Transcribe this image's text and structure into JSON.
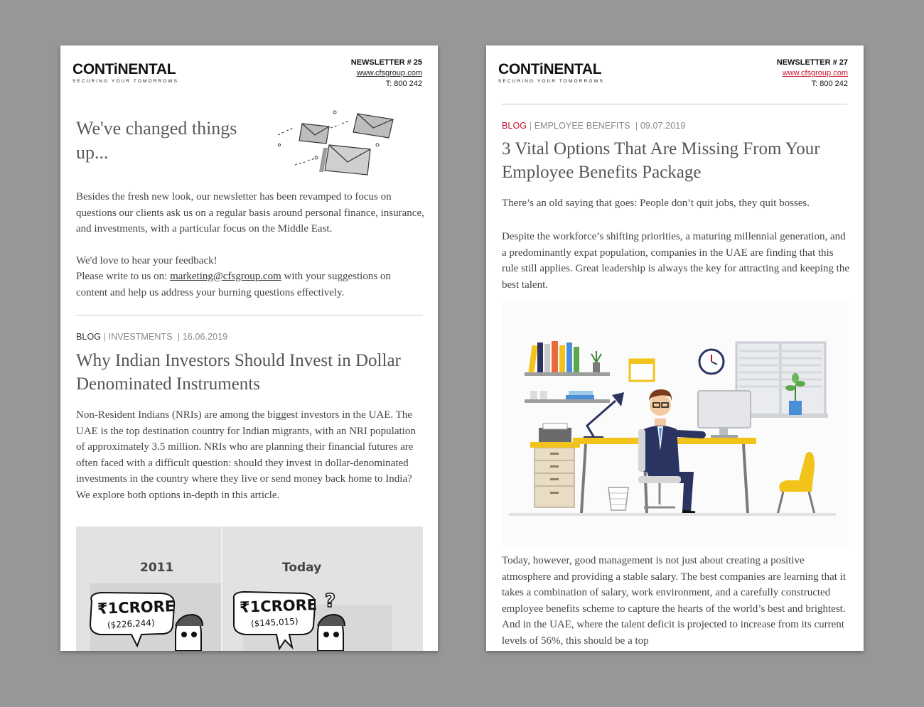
{
  "left": {
    "logo": {
      "wordmark": "CONTiNENTAL",
      "tagline": "SECURING YOUR TOMORROWS"
    },
    "newsletter": {
      "number": "NEWSLETTER # 25",
      "url": "www.cfsgroup.com",
      "phone": "T: 800 242"
    },
    "hero": {
      "title": "We've changed things up...",
      "paragraph1": "Besides the fresh new look, our newsletter has been revamped to focus on questions our clients ask us on a regular basis around personal finance, insurance, and investments, with a particular focus on the Middle East.",
      "paragraph2_line1": "We'd love to hear your feedback!",
      "paragraph2_prefix": "Please write to us on: ",
      "email": "marketing@cfsgroup.com",
      "paragraph2_suffix": " with your suggestions on content and help us address your burning questions effectively."
    },
    "article": {
      "category_main": "BLOG",
      "category_sub": "INVESTMENTS",
      "date": "16.06.2019",
      "title": "Why Indian Investors Should Invest in Dollar Denominated Instruments",
      "body": "Non-Resident Indians (NRIs) are among the biggest investors in the UAE. The UAE is the top destination country for Indian migrants, with an NRI population of approximately 3.5 million. NRIs who are planning their financial futures are often faced with a difficult question: should they invest in dollar-denominated investments in the country where they live or send money back home to India? We explore both options in-depth in this article."
    },
    "comic": {
      "label_left": "2011",
      "label_right": "Today",
      "bubble_left_main": "₹1CRORE",
      "bubble_left_sub": "($226,244)",
      "bubble_right_main": "₹1CRORE",
      "bubble_right_sub": "($145,015)",
      "question_mark": "?"
    }
  },
  "right": {
    "logo": {
      "wordmark": "CONTiNENTAL",
      "tagline": "SECURING YOUR TOMORROWS"
    },
    "newsletter": {
      "number": "NEWSLETTER # 27",
      "url": "www.cfsgroup.com",
      "phone": "T: 800 242"
    },
    "article": {
      "category_main": "BLOG",
      "category_sub": "EMPLOYEE BENEFITS",
      "date": "09.07.2019",
      "title": "3 Vital Options That Are Missing From Your Employee Benefits Package",
      "paragraph1": "There’s an old saying that goes: People don’t quit jobs, they quit bosses.",
      "paragraph2": "Despite the workforce’s shifting priorities, a maturing millennial generation, and a predominantly expat population, companies in the UAE are finding that this rule still applies. Great leadership is always the key for attracting and keeping the best talent.",
      "paragraph3": "Today, however, good management is not just about creating a positive atmosphere and providing a stable salary. The best companies are learning that it takes a combination of salary, work environment, and a carefully constructed employee benefits scheme to capture the hearts of the world’s best and brightest. And in the UAE, where the talent deficit is projected to increase from its current levels of 56%, this should be a top"
    }
  },
  "colors": {
    "background": "#979797",
    "accent_red": "#c8102e",
    "title_gray": "#555555",
    "yellow": "#f2c31a",
    "navy": "#2b3360"
  },
  "icons": [
    "envelope-icon",
    "office-illustration",
    "comic-illustration"
  ]
}
